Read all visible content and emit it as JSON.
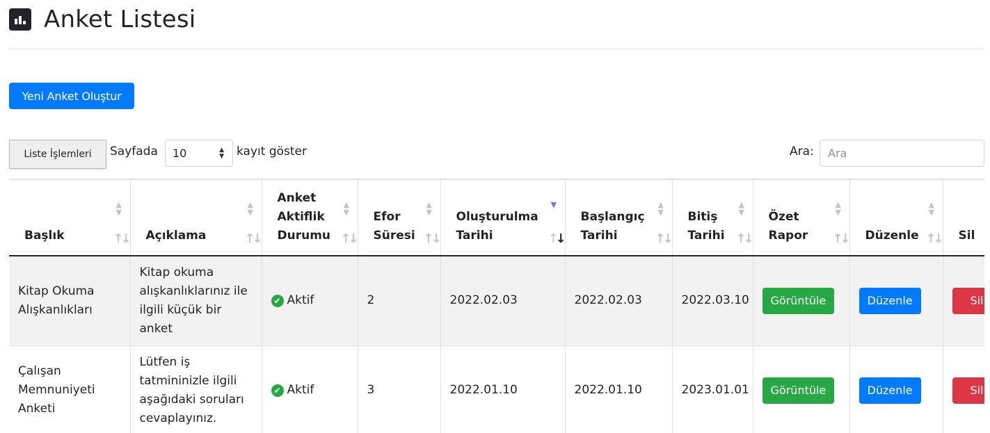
{
  "header": {
    "title": "Anket Listesi",
    "icon": "bar-chart-icon"
  },
  "actions": {
    "new_survey": "Yeni Anket Oluştur",
    "list_operations": "Liste İşlemleri"
  },
  "length_menu": {
    "prefix": "Sayfada",
    "value": "10",
    "suffix": "kayıt göster"
  },
  "search": {
    "label": "Ara:",
    "placeholder": "Ara"
  },
  "table": {
    "columns": [
      {
        "label": "Başlık"
      },
      {
        "label": "Açıklama"
      },
      {
        "label": "Anket Aktiflik Durumu"
      },
      {
        "label": "Efor Süresi"
      },
      {
        "label": "Oluşturulma Tarihi",
        "sorted": "desc"
      },
      {
        "label": "Başlangıç Tarihi"
      },
      {
        "label": "Bitiş Tarihi"
      },
      {
        "label": "Özet Rapor"
      },
      {
        "label": "Düzenle"
      },
      {
        "label": "Sil"
      }
    ],
    "rows": [
      {
        "title": "Kitap Okuma Alışkanlıkları",
        "description": "Kitap okuma alışkanlıklarınız ile ilgili küçük bir anket",
        "status": "Aktif",
        "effort": "2",
        "created": "2022.02.03",
        "start": "2022.02.03",
        "end": "2022.03.10",
        "report_btn": "Görüntüle",
        "edit_btn": "Düzenle",
        "delete_btn": "Sil"
      },
      {
        "title": "Çalışan Memnuniyeti Anketi",
        "description": "Lütfen iş tatmininizle ilgili aşağıdaki soruları cevaplayınız.",
        "status": "Aktif",
        "effort": "3",
        "created": "2022.01.10",
        "start": "2022.01.10",
        "end": "2023.01.01",
        "report_btn": "Görüntüle",
        "edit_btn": "Düzenle",
        "delete_btn": "Sil"
      }
    ]
  },
  "colors": {
    "primary": "#007bff",
    "success": "#28a745",
    "danger": "#dc3545"
  }
}
